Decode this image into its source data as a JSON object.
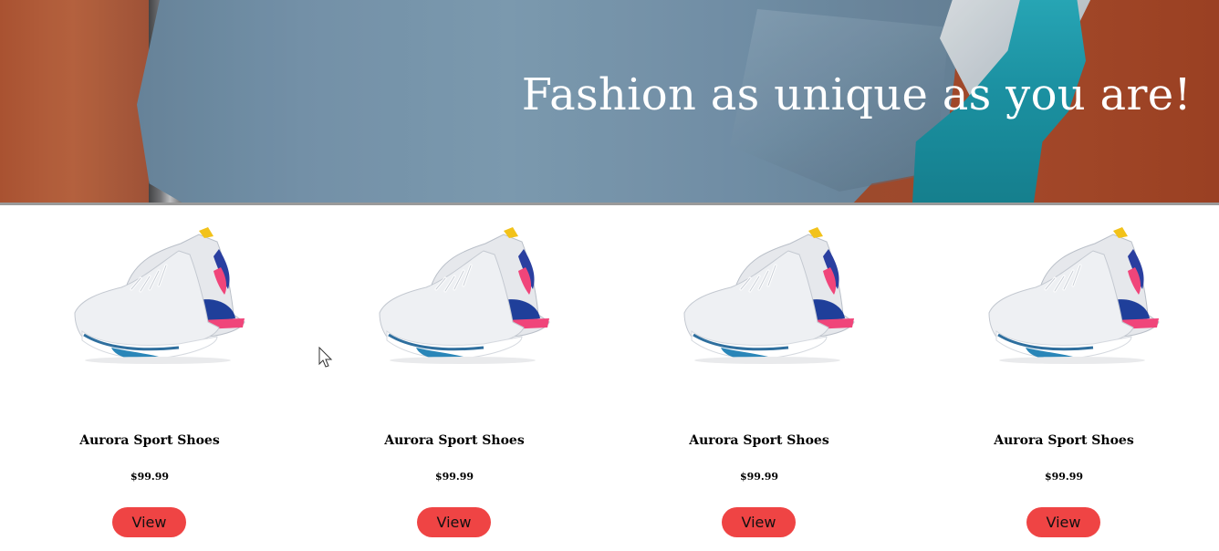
{
  "hero": {
    "title": "Fashion as unique as you are!"
  },
  "products": [
    {
      "name": "Aurora Sport Shoes",
      "price": "$99.99",
      "button_label": "View"
    },
    {
      "name": "Aurora Sport Shoes",
      "price": "$99.99",
      "button_label": "View"
    },
    {
      "name": "Aurora Sport Shoes",
      "price": "$99.99",
      "button_label": "View"
    },
    {
      "name": "Aurora Sport Shoes",
      "price": "$99.99",
      "button_label": "View"
    }
  ],
  "colors": {
    "button": "#ef4444",
    "hero_overlay_text": "#ffffff"
  },
  "icons": {
    "product_image": "sneaker-image",
    "cursor": "mouse-pointer-icon"
  }
}
